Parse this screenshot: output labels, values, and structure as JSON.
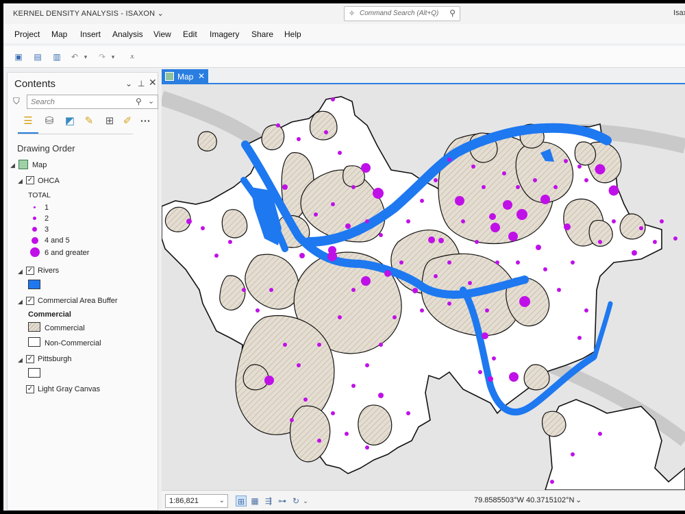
{
  "window": {
    "title": "KERNEL DENSITY ANALYSIS - ISAXON",
    "title_chevron": "⌄",
    "user": "Isax"
  },
  "command_search": {
    "placeholder": "Command Search (Alt+Q)"
  },
  "menu": [
    "Project",
    "Map",
    "Insert",
    "Analysis",
    "View",
    "Edit",
    "Imagery",
    "Share",
    "Help"
  ],
  "quick_access": [
    "new-project-icon",
    "open-project-icon",
    "save-project-icon",
    "undo-icon",
    "redo-icon",
    "customize-icon"
  ],
  "contents": {
    "title": "Contents",
    "search_placeholder": "Search",
    "drawing_order_label": "Drawing Order",
    "map_label": "Map",
    "layers": {
      "ohca": {
        "label": "OHCA",
        "field": "TOTAL",
        "classes": [
          "1",
          "2",
          "3",
          "4 and 5",
          "6 and greater"
        ],
        "color": "#c010e8"
      },
      "rivers": {
        "label": "Rivers",
        "color": "#1e78f0"
      },
      "commercial": {
        "label": "Commercial Area Buffer",
        "field": "Commercial",
        "classes": [
          "Commercial",
          "Non-Commercial"
        ]
      },
      "pittsburgh": {
        "label": "Pittsburgh"
      },
      "basemap": {
        "label": "Light Gray Canvas"
      }
    }
  },
  "map_tab": {
    "label": "Map"
  },
  "status": {
    "scale": "1:86,821",
    "coordinates": "79.8585503°W 40.3715102°N"
  },
  "colors": {
    "accent": "#2a7ee0",
    "ohca_point": "#c010e8",
    "river": "#1e78f0",
    "commercial_fill": "#e4ddd2"
  }
}
